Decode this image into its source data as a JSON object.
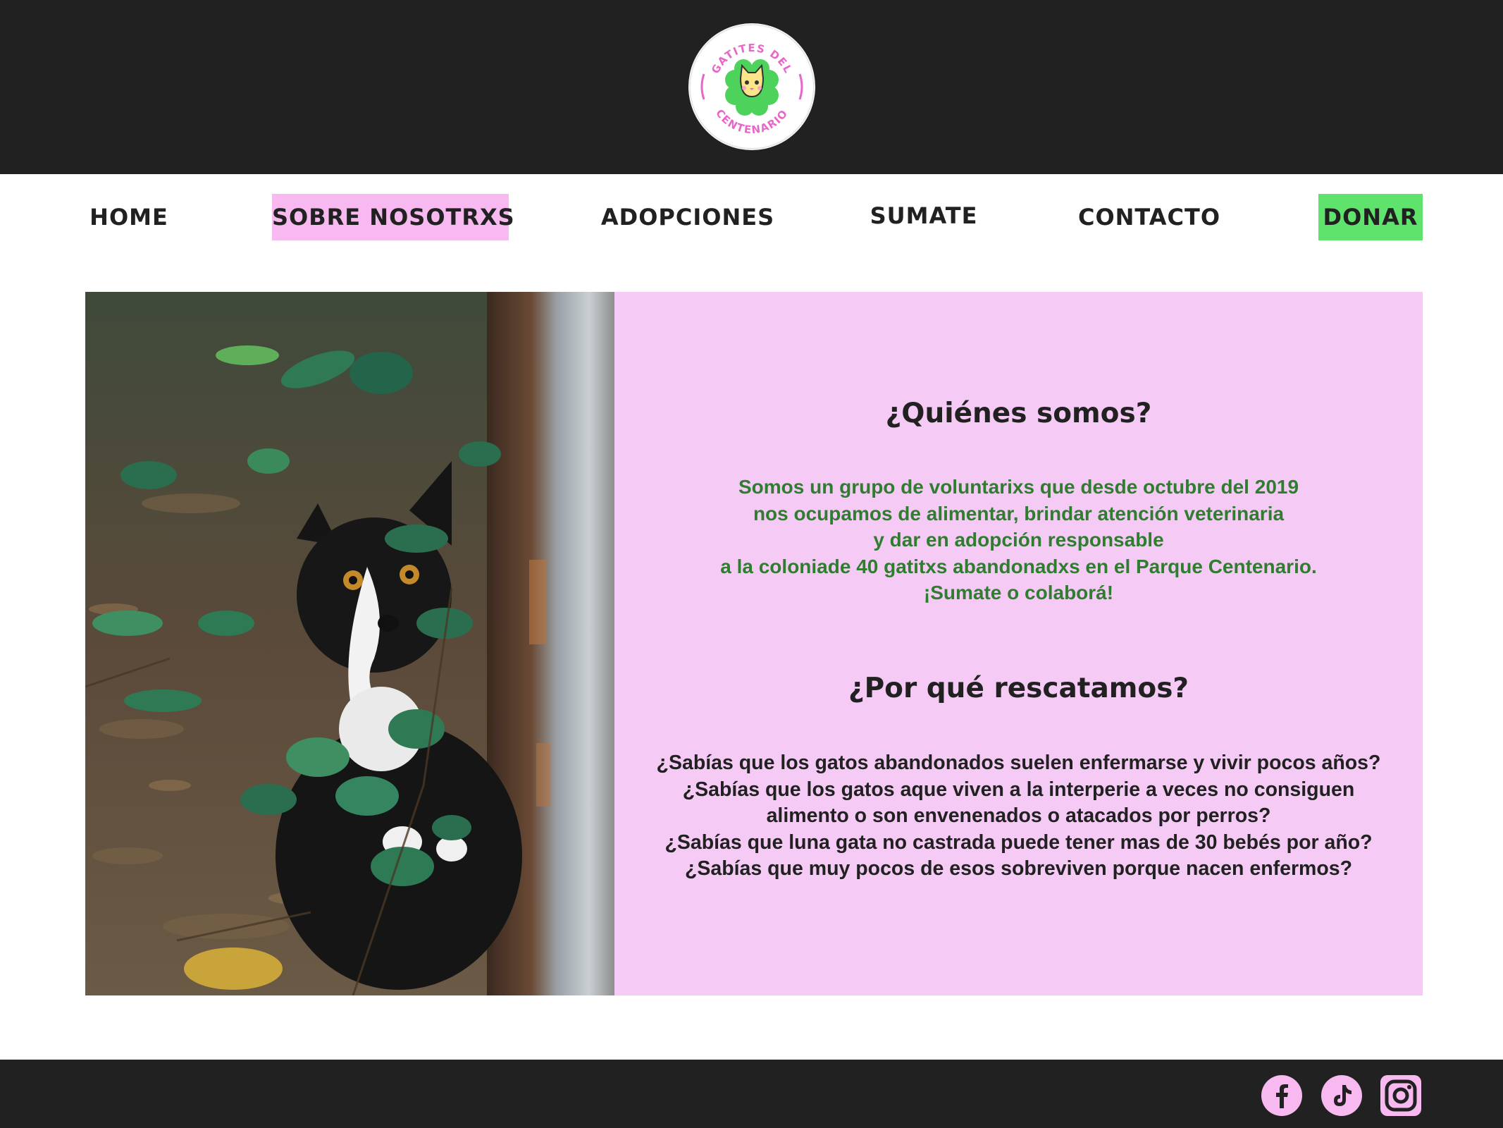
{
  "brand": {
    "logo_top_text": "GATITES DEL",
    "logo_bottom_text": "CENTENARIO",
    "colors": {
      "pink": "#f7b9ef",
      "green": "#5fe36d",
      "dark": "#212121",
      "panel": "#f5cbf5",
      "text_green": "#2f7d2f"
    }
  },
  "nav": {
    "home": "HOME",
    "about": "SOBRE NOSOTRXS",
    "adoptions": "ADOPCIONES",
    "join": "SUMATE",
    "contact": "CONTACTO",
    "donate": "DONAR",
    "active": "SOBRE NOSOTRXS"
  },
  "about": {
    "who_title": "¿Quiénes somos?",
    "who_lines": [
      "Somos un grupo de voluntarixs que desde octubre del 2019",
      "nos ocupamos de alimentar, brindar atención veterinaria",
      "y dar en adopción responsable",
      "a la coloniade 40 gatitxs abandonadxs en el Parque Centenario.",
      "¡Sumate o colaborá!"
    ],
    "why_title": "¿Por qué rescatamos?",
    "why_lines": [
      "¿Sabías que los gatos abandonados suelen enfermarse y vivir pocos años?",
      "¿Sabías que los gatos aque viven a la interperie a veces no consiguen",
      "alimento o son envenenados o atacados por perros?",
      "¿Sabías que luna gata no castrada puede tener mas de 30 bebés por año?",
      "¿Sabías que muy pocos de esos sobreviven porque nacen enfermos?"
    ]
  },
  "footer": {
    "social_icons": [
      "facebook-icon",
      "tiktok-icon",
      "instagram-icon"
    ]
  }
}
